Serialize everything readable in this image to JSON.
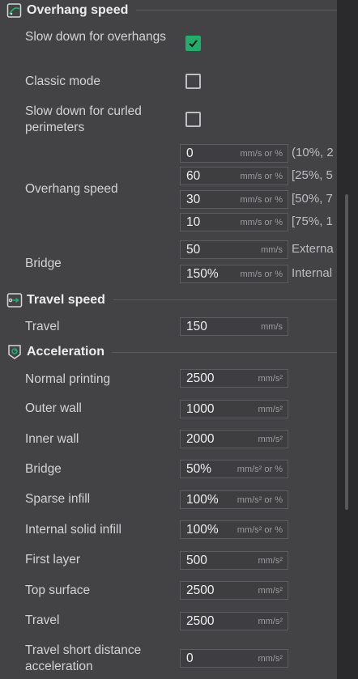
{
  "sections": {
    "overhang": {
      "title": "Overhang speed",
      "slow_down_label": "Slow down for overhangs",
      "slow_down_checked": true,
      "classic_label": "Classic mode",
      "classic_checked": false,
      "curled_label": "Slow down for curled perimeters",
      "curled_checked": false,
      "overhang_speed_label": "Overhang speed",
      "overhang_rows": [
        {
          "value": "0",
          "unit": "mm/s or %",
          "hint": "(10%, 2"
        },
        {
          "value": "60",
          "unit": "mm/s or %",
          "hint": "[25%, 5"
        },
        {
          "value": "30",
          "unit": "mm/s or %",
          "hint": "[50%, 7"
        },
        {
          "value": "10",
          "unit": "mm/s or %",
          "hint": "[75%, 1"
        }
      ],
      "bridge_label": "Bridge",
      "bridge_rows": [
        {
          "value": "50",
          "unit": "mm/s",
          "hint": "Externa"
        },
        {
          "value": "150%",
          "unit": "mm/s or %",
          "hint": "Internal"
        }
      ]
    },
    "travel": {
      "title": "Travel speed",
      "travel_label": "Travel",
      "travel_value": "150",
      "travel_unit": "mm/s"
    },
    "acceleration": {
      "title": "Acceleration",
      "rows": [
        {
          "label": "Normal printing",
          "value": "2500",
          "unit": "mm/s²"
        },
        {
          "label": "Outer wall",
          "value": "1000",
          "unit": "mm/s²"
        },
        {
          "label": "Inner wall",
          "value": "2000",
          "unit": "mm/s²"
        },
        {
          "label": "Bridge",
          "value": "50%",
          "unit": "mm/s² or %"
        },
        {
          "label": "Sparse infill",
          "value": "100%",
          "unit": "mm/s² or %"
        },
        {
          "label": "Internal solid infill",
          "value": "100%",
          "unit": "mm/s² or %"
        },
        {
          "label": "First layer",
          "value": "500",
          "unit": "mm/s²"
        },
        {
          "label": "Top surface",
          "value": "2500",
          "unit": "mm/s²"
        },
        {
          "label": "Travel",
          "value": "2500",
          "unit": "mm/s²"
        },
        {
          "label": "Travel short distance acceleration",
          "value": "0",
          "unit": "mm/s²"
        }
      ]
    }
  },
  "icons": {
    "overhang": "overhang-speed-icon",
    "travel": "travel-speed-icon",
    "acceleration": "acceleration-icon",
    "check": "checkmark-icon"
  },
  "colors": {
    "accent": "#1fae6b",
    "background": "#434345",
    "field": "#3e3e40"
  }
}
